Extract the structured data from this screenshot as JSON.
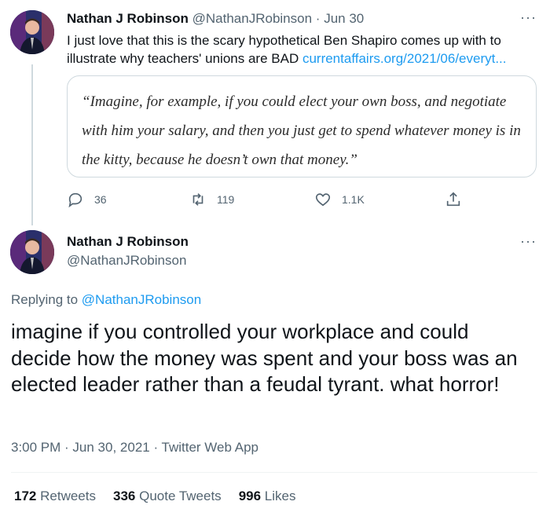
{
  "parent_tweet": {
    "name": "Nathan J Robinson",
    "handle": "@NathanJRobinson",
    "separator": "·",
    "date": "Jun 30",
    "text": "I just love that this is the scary hypothetical Ben Shapiro comes up with to illustrate why teachers' unions are BAD",
    "link": "currentaffairs.org/2021/06/everyt...",
    "quote": "“Imagine, for example, if you could elect your own boss, and negotiate with him your salary, and then you just get to spend whatever money is in the kitty, because he doesn’t own that money.”",
    "actions": {
      "replies": "36",
      "retweets": "119",
      "likes": "1.1K"
    },
    "more": "···"
  },
  "main_tweet": {
    "name": "Nathan J Robinson",
    "handle": "@NathanJRobinson",
    "more": "···",
    "replying_prefix": "Replying to",
    "replying_to": "@NathanJRobinson",
    "text": "imagine if you controlled your workplace and could decide how the money was spent and your boss was an elected leader rather than a feudal tyrant. what horror!",
    "timestamp": "3:00 PM · Jun 30, 2021 · Twitter Web App",
    "stats": {
      "retweets_count": "172",
      "retweets_label": "Retweets",
      "quotes_count": "336",
      "quotes_label": "Quote Tweets",
      "likes_count": "996",
      "likes_label": "Likes"
    }
  },
  "colors": {
    "link": "#1d9bf0",
    "text": "#0f1419",
    "muted": "#536471",
    "border": "#cfd9de"
  }
}
